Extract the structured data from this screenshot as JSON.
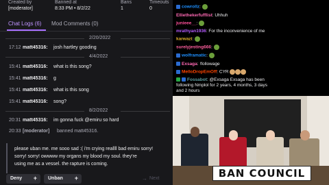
{
  "header": {
    "col1_label": "Created by",
    "col1_value": "[moderator]",
    "col2_label": "Banned at",
    "col2_value": "8:33 PM • 8/2/22",
    "col3_label": "Bans",
    "col3_value": "1",
    "col4_label": "Timeouts",
    "col4_value": "0"
  },
  "tabs": [
    "Chat Logs (6)",
    "Mod Comments (0)"
  ],
  "dates": [
    "2/20/2022",
    "4/4/2022",
    "8/2/2022"
  ],
  "logs": [
    {
      "time": "17:12",
      "user": "matt45316:",
      "msg": "josh hartley gooding"
    },
    {
      "time": "15:41",
      "user": "matt45316:",
      "msg": "what is this song?"
    },
    {
      "time": "15:41",
      "user": "matt45316:",
      "msg": "g"
    },
    {
      "time": "15:41",
      "user": "matt45316:",
      "msg": "what is this song"
    },
    {
      "time": "15:41",
      "user": "matt45316:",
      "msg": "song?"
    },
    {
      "time": "20:31",
      "user": "matt45316:",
      "msg": "im gonna fuck @emiru so hard"
    },
    {
      "time": "20:33",
      "user": "[moderator]",
      "msg": "banned matt45316."
    }
  ],
  "unban_request": [
    "please uban me. me sooo sad :( i'm crying reallll bad emiru sorry!",
    "sorry! sorry! owwww my organs my blood my soul. they're",
    "using me as a vessel. the rapture is coming."
  ],
  "buttons": {
    "deny": "Deny",
    "unban": "Unban",
    "next": "Next"
  },
  "chat": [
    {
      "user": "cowrollz",
      "color": "#1e90ff",
      "msg": ""
    },
    {
      "user": "Elliethekerfufflist",
      "color": "#ff69b4",
      "msg": "Uhhuh"
    },
    {
      "user": "junieee__",
      "color": "#ff4f9a",
      "msg": ""
    },
    {
      "user": "mrathyan1936",
      "color": "#b65cff",
      "msg": "For the inconvenience of me"
    },
    {
      "user": "karwazi",
      "color": "#e0b02a",
      "msg": ""
    },
    {
      "user": "surelyjesting666",
      "color": "#ff5f9e",
      "msg": ""
    },
    {
      "user": "wolframatic",
      "color": "#1e90ff",
      "msg": ""
    },
    {
      "user": "Exsaga",
      "color": "#ff69b4",
      "msg": "!followage"
    },
    {
      "user": "MelloDropEmOff",
      "color": "#ff4500",
      "msg": "CYR"
    },
    {
      "user": "Fossabot",
      "color": "#5f9ea0",
      "msg": "@Exsaga Exsaga has been"
    },
    {
      "user": "",
      "color": "#efeff1",
      "msg": "following Nmplol for 2 years, 4 months, 3 days"
    },
    {
      "user": "",
      "color": "#efeff1",
      "msg": "and 2 hours"
    }
  ],
  "video": {
    "banner_text": "BAN COUNCIL"
  }
}
